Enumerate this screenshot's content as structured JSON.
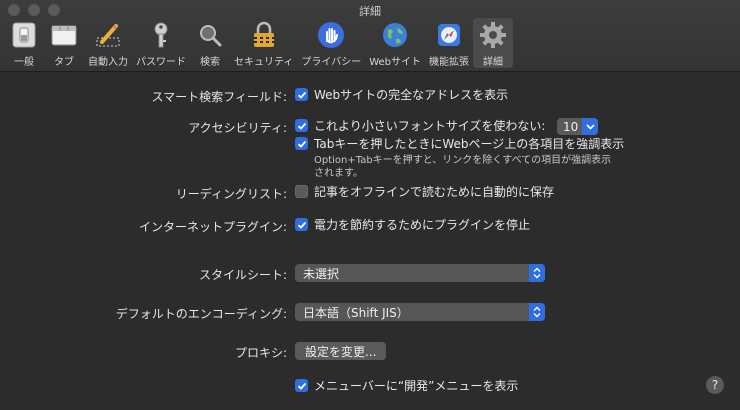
{
  "window": {
    "title": "詳細"
  },
  "toolbar": {
    "items": [
      {
        "label": "一般",
        "icon": "general-switch-icon"
      },
      {
        "label": "タブ",
        "icon": "tabs-window-icon"
      },
      {
        "label": "自動入力",
        "icon": "autofill-pencil-icon"
      },
      {
        "label": "パスワード",
        "icon": "key-icon"
      },
      {
        "label": "検索",
        "icon": "magnifier-icon"
      },
      {
        "label": "セキュリティ",
        "icon": "padlock-icon"
      },
      {
        "label": "プライバシー",
        "icon": "hand-icon"
      },
      {
        "label": "Webサイト",
        "icon": "globe-icon"
      },
      {
        "label": "機能拡張",
        "icon": "extensions-icon"
      },
      {
        "label": "詳細",
        "icon": "gear-icon"
      }
    ],
    "selected_index": 9
  },
  "rows": {
    "smart_search": {
      "label": "スマート検索フィールド:",
      "checkbox": "Webサイトの完全なアドレスを表示",
      "checked": true
    },
    "accessibility": {
      "label": "アクセシビリティ:",
      "font_checkbox": "これより小さいフォントサイズを使わない:",
      "font_checked": true,
      "font_size": "10",
      "tab_checkbox": "Tabキーを押したときにWebページ上の各項目を強調表示",
      "tab_checked": true,
      "note_line1": "Option+Tabキーを押すと、リンクを除くすべての項目が強調表示",
      "note_line2": "されます。"
    },
    "reading_list": {
      "label": "リーディングリスト:",
      "checkbox": "記事をオフラインで読むために自動的に保存",
      "checked": false
    },
    "plugins": {
      "label": "インターネットプラグイン:",
      "checkbox": "電力を節約するためにプラグインを停止",
      "checked": true
    },
    "stylesheet": {
      "label": "スタイルシート:",
      "value": "未選択"
    },
    "encoding": {
      "label": "デフォルトのエンコーディング:",
      "value": "日本語（Shift JIS）"
    },
    "proxy": {
      "label": "プロキシ:",
      "button": "設定を変更..."
    },
    "develop": {
      "checkbox": "メニューバーに“開発”メニューを表示",
      "checked": true
    }
  },
  "help": "?",
  "colors": {
    "accent": "#2f6ee0",
    "background": "#2c2c2c"
  }
}
